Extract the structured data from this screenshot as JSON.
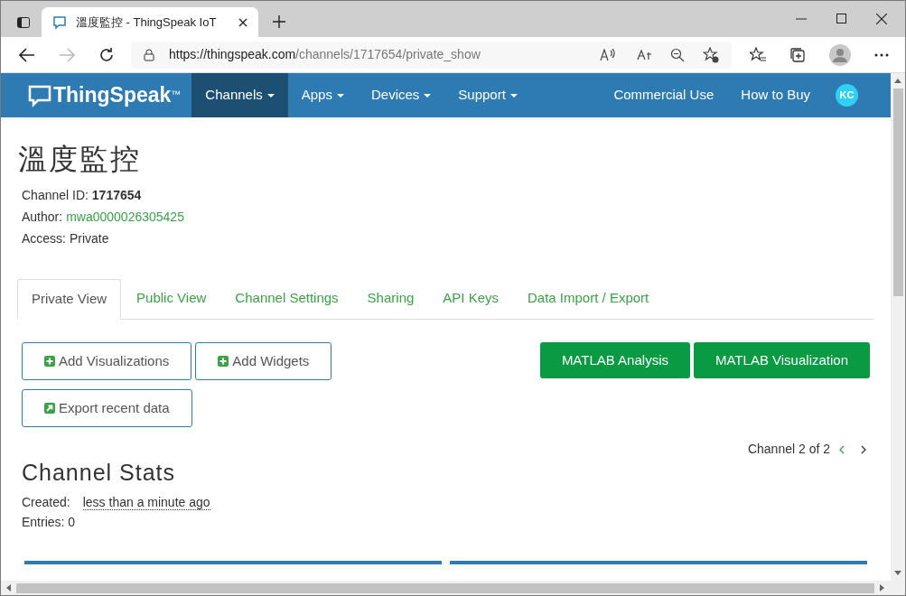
{
  "browser": {
    "tab_title": "溫度監控 - ThingSpeak IoT",
    "url_host": "https://thingspeak.com",
    "url_path": "/channels/1717654/private_show"
  },
  "navbar": {
    "brand": "ThingSpeak",
    "brand_mark": "™",
    "items": [
      {
        "label": "Channels",
        "selected": true
      },
      {
        "label": "Apps",
        "selected": false
      },
      {
        "label": "Devices",
        "selected": false
      },
      {
        "label": "Support",
        "selected": false
      }
    ],
    "right_links": [
      "Commercial Use",
      "How to Buy"
    ],
    "avatar": "KC"
  },
  "channel": {
    "title": "溫度監控",
    "id_line": "Channel ID: **1717654**",
    "author_label": "Author:",
    "author": "mwa0000026305425",
    "access": "Access: Private"
  },
  "tabs": [
    {
      "label": "Private View",
      "selected": true
    },
    {
      "label": "Public View",
      "selected": false
    },
    {
      "label": "Channel Settings",
      "selected": false
    },
    {
      "label": "Sharing",
      "selected": false
    },
    {
      "label": "API Keys",
      "selected": false
    },
    {
      "label": "Data Import / Export",
      "selected": false
    }
  ],
  "left_buttons": [
    {
      "label": "Add Visualizations",
      "kind": "plus"
    },
    {
      "label": "Add Widgets",
      "kind": "plus"
    },
    {
      "label": "Export recent data",
      "kind": "export"
    }
  ],
  "right_buttons": [
    "MATLAB Analysis",
    "MATLAB Visualization"
  ],
  "pager": "Channel 2 of 2",
  "stats": {
    "heading": "Channel Stats",
    "created_label": "Created:",
    "created": "less than a minute ago",
    "entries": "Entries: 0"
  }
}
